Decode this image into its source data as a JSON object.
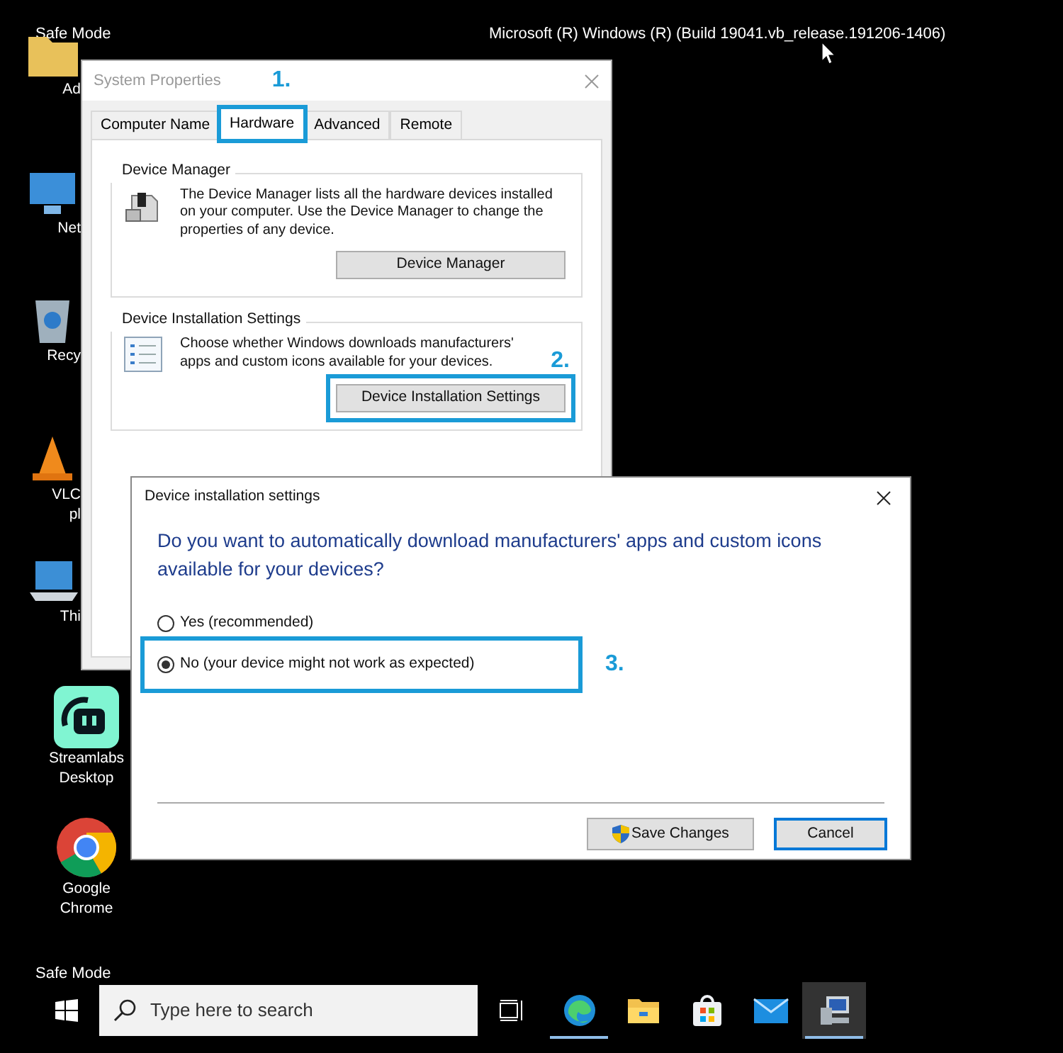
{
  "desktop": {
    "top_left_label": "Safe Mode",
    "build_info": "Microsoft (R) Windows (R) (Build 19041.vb_release.191206-1406)",
    "bottom_left_label": "Safe Mode"
  },
  "desktop_icons": [
    {
      "kind": "folder",
      "lines": [
        "Ad"
      ]
    },
    {
      "kind": "network",
      "lines": [
        "Net"
      ]
    },
    {
      "kind": "recycle",
      "lines": [
        "Recy"
      ]
    },
    {
      "kind": "vlc",
      "lines": [
        "VLC",
        "pl"
      ]
    },
    {
      "kind": "pc",
      "lines": [
        "Thi"
      ]
    },
    {
      "kind": "streamlabs",
      "lines": [
        "Streamlabs",
        "Desktop"
      ]
    },
    {
      "kind": "chrome",
      "lines": [
        "Google",
        "Chrome"
      ]
    }
  ],
  "system_properties": {
    "title": "System Properties",
    "step_label": "1.",
    "tabs": [
      {
        "label": "Computer Name",
        "selected": false,
        "highlighted": false
      },
      {
        "label": "Hardware",
        "selected": true,
        "highlighted": true
      },
      {
        "label": "Advanced",
        "selected": false,
        "highlighted": false
      },
      {
        "label": "Remote",
        "selected": false,
        "highlighted": false
      }
    ],
    "groups": [
      {
        "kind": "device",
        "title": "Device Manager",
        "text": "The Device Manager lists all the hardware devices installed on your computer. Use the Device Manager to change the properties of any device.",
        "button": "Device Manager",
        "highlighted": false
      },
      {
        "kind": "checklist",
        "title": "Device Installation Settings",
        "text": "Choose whether Windows downloads manufacturers' apps and custom icons available for your devices.",
        "step_label": "2.",
        "button": "Device Installation Settings",
        "highlighted": true
      }
    ]
  },
  "dialog": {
    "title": "Device installation settings",
    "question": "Do you want to automatically download manufacturers' apps and custom icons available for your devices?",
    "options": [
      {
        "label": "Yes (recommended)",
        "selected": false,
        "highlighted": false
      },
      {
        "label": "No (your device might not work as expected)",
        "selected": true,
        "highlighted": true
      }
    ],
    "step_label": "3.",
    "buttons": [
      {
        "label": "Save Changes",
        "kind": "shield"
      },
      {
        "label": "Cancel",
        "kind": "default"
      }
    ]
  },
  "taskbar": {
    "search": {
      "placeholder": "Type here to search"
    },
    "apps": [
      {
        "kind": "edge",
        "running": true,
        "active": false
      },
      {
        "kind": "explorer",
        "running": false,
        "active": false
      },
      {
        "kind": "store",
        "running": false,
        "active": false
      },
      {
        "kind": "mail",
        "running": false,
        "active": false
      },
      {
        "kind": "system",
        "running": true,
        "active": true
      }
    ]
  }
}
